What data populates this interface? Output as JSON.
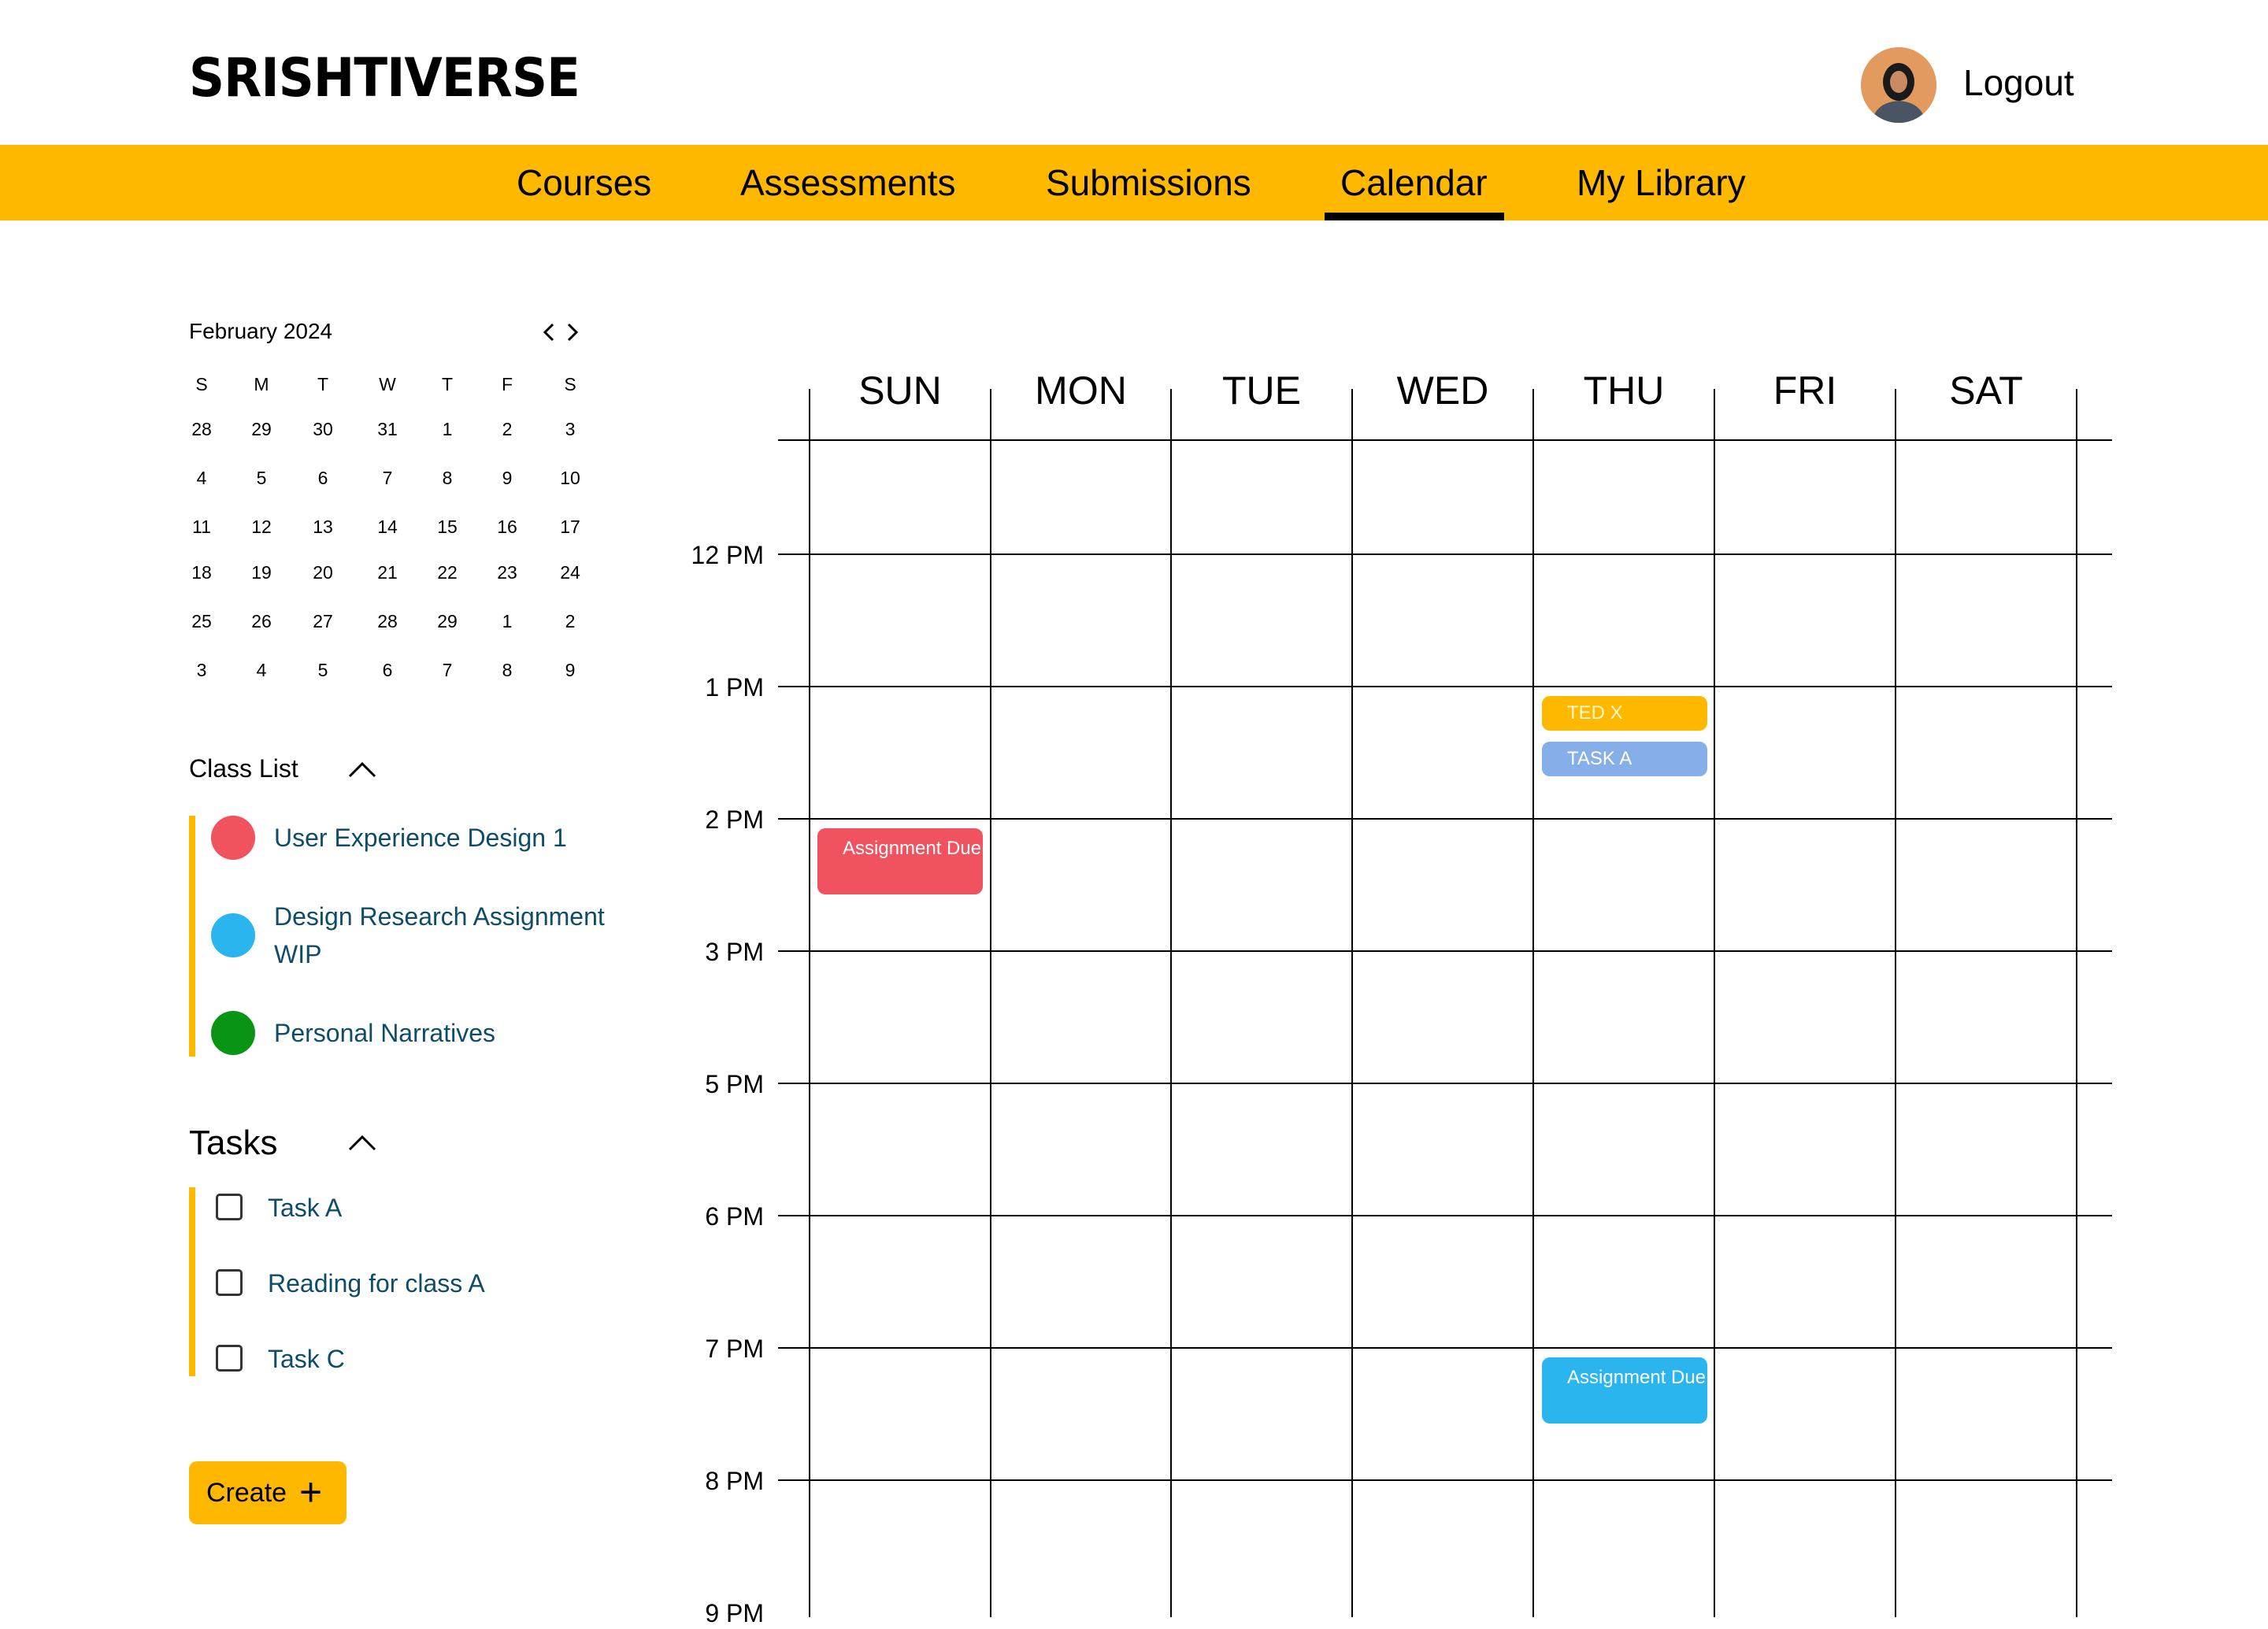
{
  "header": {
    "logo": "SRISHTIVERSE",
    "logout": "Logout"
  },
  "nav": {
    "items": [
      {
        "label": "Courses"
      },
      {
        "label": "Assessments"
      },
      {
        "label": "Submissions"
      },
      {
        "label": "Calendar",
        "active": true
      },
      {
        "label": "My Library"
      }
    ]
  },
  "mini_calendar": {
    "month": "February 2024",
    "weekdays": [
      "S",
      "M",
      "T",
      "W",
      "T",
      "F",
      "S"
    ],
    "weeks": [
      [
        "28",
        "29",
        "30",
        "31",
        "1",
        "2",
        "3"
      ],
      [
        "4",
        "5",
        "6",
        "7",
        "8",
        "9",
        "10"
      ],
      [
        "11",
        "12",
        "13",
        "14",
        "15",
        "16",
        "17"
      ],
      [
        "18",
        "19",
        "20",
        "21",
        "22",
        "23",
        "24"
      ],
      [
        "25",
        "26",
        "27",
        "28",
        "29",
        "1",
        "2"
      ],
      [
        "3",
        "4",
        "5",
        "6",
        "7",
        "8",
        "9"
      ]
    ]
  },
  "class_list": {
    "title": "Class List",
    "items": [
      {
        "label": "User Experience Design 1",
        "color": "#f0525f"
      },
      {
        "label": "Design Research Assignment WIP",
        "color": "#2bb5ee"
      },
      {
        "label": "Personal Narratives",
        "color": "#0a9416"
      }
    ]
  },
  "tasks": {
    "title": "Tasks",
    "items": [
      {
        "label": "Task A"
      },
      {
        "label": "Reading for class A"
      },
      {
        "label": "Task C"
      }
    ]
  },
  "create_button": {
    "label": "Create"
  },
  "week": {
    "days": [
      "SUN",
      "MON",
      "TUE",
      "WED",
      "THU",
      "FRI",
      "SAT"
    ],
    "times": [
      "12 PM",
      "1 PM",
      "2 PM",
      "3 PM",
      "5 PM",
      "6 PM",
      "7 PM",
      "8 PM",
      "9 PM"
    ],
    "events": [
      {
        "label": "TED X",
        "day": "THU",
        "color": "#ffb800",
        "text_color": "#fff7d0"
      },
      {
        "label": "TASK A",
        "day": "THU",
        "color": "#86aee9",
        "text_color": "#ffffff"
      },
      {
        "label": "Assignment Due",
        "day": "SUN",
        "color": "#f0525f",
        "text_color": "#ffffff"
      },
      {
        "label": "Assignment Due",
        "day": "THU",
        "color": "#2bb5ee",
        "text_color": "#ffffff"
      }
    ]
  },
  "colors": {
    "accent": "#ffb800",
    "link": "#0f4c68"
  }
}
